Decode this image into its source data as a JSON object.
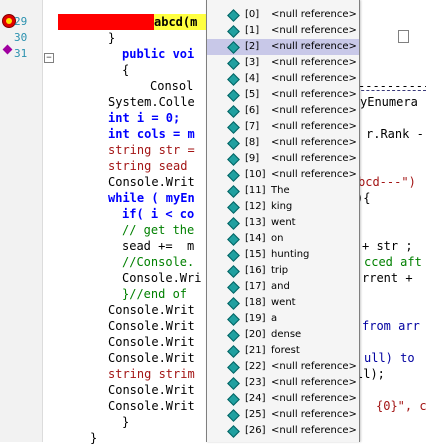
{
  "gutter": {
    "line_numbers": [
      "29",
      "30",
      "31"
    ]
  },
  "code": {
    "highlight_text": "abcd(m",
    "lines": [
      {
        "text": "}",
        "cls": ""
      },
      {
        "text": "public voi",
        "cls": "kw"
      },
      {
        "text": "{",
        "cls": ""
      },
      {
        "text": "Consol",
        "cls": ""
      },
      {
        "text": "System.Colle",
        "cls": ""
      },
      {
        "text": "int i = 0;",
        "cls": "kw"
      },
      {
        "text": "int cols = m",
        "cls": "kw"
      },
      {
        "text": "string str =",
        "cls": "st"
      },
      {
        "text": "string sead",
        "cls": "st"
      },
      {
        "text": "Console.Writ",
        "cls": ""
      },
      {
        "text": "while ( myEn",
        "cls": "kw"
      },
      {
        "text": "if( i < co",
        "cls": "kw"
      },
      {
        "text": "// get the",
        "cls": "cm"
      },
      {
        "text": "sead +=  m",
        "cls": ""
      },
      {
        "text": "//Console.",
        "cls": "cm"
      },
      {
        "text": "Console.Wri",
        "cls": ""
      },
      {
        "text": "}//end of",
        "cls": "cm"
      },
      {
        "text": "Console.Writ",
        "cls": ""
      },
      {
        "text": "Console.Writ",
        "cls": ""
      },
      {
        "text": "Console.Writ",
        "cls": ""
      },
      {
        "text": "Console.Writ",
        "cls": ""
      },
      {
        "text": "string strim",
        "cls": "st"
      },
      {
        "text": "Console.Writ",
        "cls": ""
      },
      {
        "text": "Console.Writ",
        "cls": ""
      },
      {
        "text": "}",
        "cls": ""
      },
      {
        "text": "}",
        "cls": ""
      }
    ],
    "right_fragments": [
      {
        "text": "----------",
        "cls": ""
      },
      {
        "text": "yEnumera",
        "cls": ""
      },
      {
        "text": "r.Rank -",
        "cls": ""
      },
      {
        "text": "bcd---\")",
        "cls": "st"
      },
      {
        "text": "){",
        "cls": ""
      },
      {
        "text": "+ str ;",
        "cls": ""
      },
      {
        "text": "cced aft",
        "cls": "cm"
      },
      {
        "text": "rrent +",
        "cls": ""
      },
      {
        "text": "from arr",
        "cls": "ty"
      },
      {
        "text": "ull) to",
        "cls": "ty"
      },
      {
        "text": "ll);",
        "cls": ""
      },
      {
        "text": "{0}\", c",
        "cls": "st"
      }
    ]
  },
  "popup": {
    "items": [
      {
        "index": "[0]",
        "value": "<null reference>"
      },
      {
        "index": "[1]",
        "value": "<null reference>"
      },
      {
        "index": "[2]",
        "value": "<null reference>"
      },
      {
        "index": "[3]",
        "value": "<null reference>"
      },
      {
        "index": "[4]",
        "value": "<null reference>"
      },
      {
        "index": "[5]",
        "value": "<null reference>"
      },
      {
        "index": "[6]",
        "value": "<null reference>"
      },
      {
        "index": "[7]",
        "value": "<null reference>"
      },
      {
        "index": "[8]",
        "value": "<null reference>"
      },
      {
        "index": "[9]",
        "value": "<null reference>"
      },
      {
        "index": "[10]",
        "value": "<null reference>"
      },
      {
        "index": "[11]",
        "value": "The"
      },
      {
        "index": "[12]",
        "value": "king"
      },
      {
        "index": "[13]",
        "value": "went"
      },
      {
        "index": "[14]",
        "value": "on"
      },
      {
        "index": "[15]",
        "value": "hunting"
      },
      {
        "index": "[16]",
        "value": "trip"
      },
      {
        "index": "[17]",
        "value": "and"
      },
      {
        "index": "[18]",
        "value": "went"
      },
      {
        "index": "[19]",
        "value": "a"
      },
      {
        "index": "[20]",
        "value": "dense"
      },
      {
        "index": "[21]",
        "value": "forest"
      },
      {
        "index": "[22]",
        "value": "<null reference>"
      },
      {
        "index": "[23]",
        "value": "<null reference>"
      },
      {
        "index": "[24]",
        "value": "<null reference>"
      },
      {
        "index": "[25]",
        "value": "<null reference>"
      },
      {
        "index": "[26]",
        "value": "<null reference>"
      }
    ],
    "selected_index": 2
  }
}
